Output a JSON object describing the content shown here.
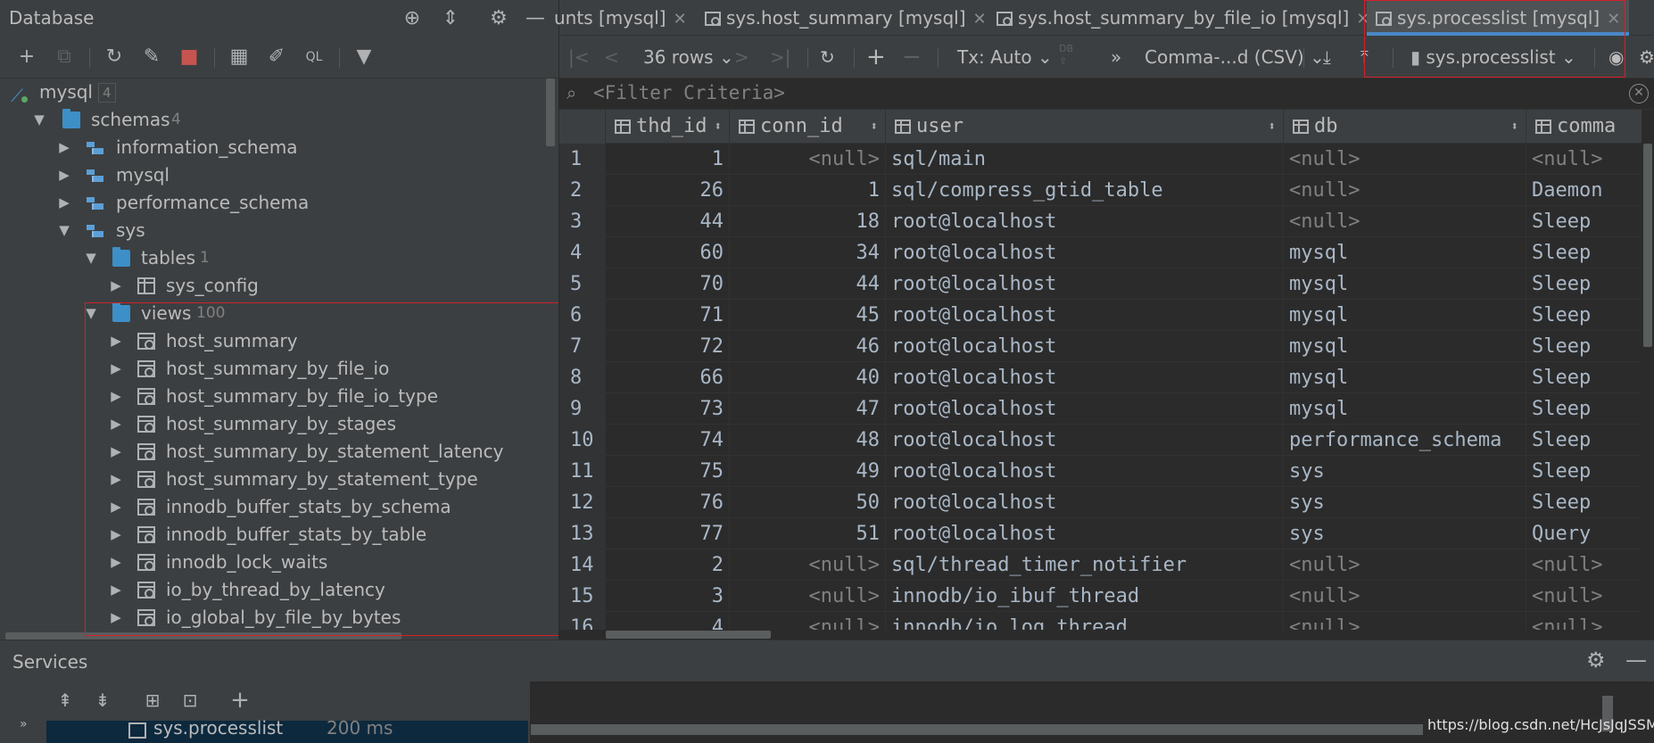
{
  "left_panel": {
    "title": "Database",
    "header_icons": [
      "globe-icon",
      "collapse-icon",
      "gear-icon",
      "minimize-icon"
    ],
    "toolbar": [
      "add-icon",
      "copy-icon",
      "refresh-icon",
      "properties-icon",
      "stop-icon",
      "table-icon",
      "edit-icon",
      "console-icon",
      "filter-icon"
    ],
    "tree": {
      "connection": {
        "label": "mysql",
        "count": "4"
      },
      "schemas": {
        "label": "schemas",
        "count": "4"
      },
      "schema_items": [
        "information_schema",
        "mysql",
        "performance_schema",
        "sys"
      ],
      "tables": {
        "label": "tables",
        "count": "1"
      },
      "table_items": [
        "sys_config"
      ],
      "views": {
        "label": "views",
        "count": "100"
      },
      "view_items": [
        "host_summary",
        "host_summary_by_file_io",
        "host_summary_by_file_io_type",
        "host_summary_by_stages",
        "host_summary_by_statement_latency",
        "host_summary_by_statement_type",
        "innodb_buffer_stats_by_schema",
        "innodb_buffer_stats_by_table",
        "innodb_lock_waits",
        "io_by_thread_by_latency",
        "io_global_by_file_by_bytes"
      ]
    }
  },
  "tabs": [
    {
      "label": "unts [mysql]"
    },
    {
      "label": "sys.host_summary [mysql]"
    },
    {
      "label": "sys.host_summary_by_file_io [mysql]"
    },
    {
      "label": "sys.processlist [mysql]",
      "active": true
    }
  ],
  "result_toolbar": {
    "rows_label": "36 rows",
    "tx_label": "Tx: Auto",
    "db_label": "DB",
    "export_format": "Comma-...d (CSV)",
    "target_label": "sys.processlist",
    "more_label": "»"
  },
  "filter": {
    "placeholder": "<Filter Criteria>"
  },
  "grid": {
    "columns": [
      "thd_id",
      "conn_id",
      "user",
      "db",
      "comma"
    ],
    "rows": [
      [
        "1",
        "1",
        "<null>",
        "sql/main",
        "<null>",
        "<null>"
      ],
      [
        "2",
        "26",
        "1",
        "sql/compress_gtid_table",
        "<null>",
        "Daemon"
      ],
      [
        "3",
        "44",
        "18",
        "root@localhost",
        "<null>",
        "Sleep"
      ],
      [
        "4",
        "60",
        "34",
        "root@localhost",
        "mysql",
        "Sleep"
      ],
      [
        "5",
        "70",
        "44",
        "root@localhost",
        "mysql",
        "Sleep"
      ],
      [
        "6",
        "71",
        "45",
        "root@localhost",
        "mysql",
        "Sleep"
      ],
      [
        "7",
        "72",
        "46",
        "root@localhost",
        "mysql",
        "Sleep"
      ],
      [
        "8",
        "66",
        "40",
        "root@localhost",
        "mysql",
        "Sleep"
      ],
      [
        "9",
        "73",
        "47",
        "root@localhost",
        "mysql",
        "Sleep"
      ],
      [
        "10",
        "74",
        "48",
        "root@localhost",
        "performance_schema",
        "Sleep"
      ],
      [
        "11",
        "75",
        "49",
        "root@localhost",
        "sys",
        "Sleep"
      ],
      [
        "12",
        "76",
        "50",
        "root@localhost",
        "sys",
        "Sleep"
      ],
      [
        "13",
        "77",
        "51",
        "root@localhost",
        "sys",
        "Query"
      ],
      [
        "14",
        "2",
        "<null>",
        "sql/thread_timer_notifier",
        "<null>",
        "<null>"
      ],
      [
        "15",
        "3",
        "<null>",
        "innodb/io_ibuf_thread",
        "<null>",
        "<null>"
      ],
      [
        "16",
        "4",
        "<null>",
        "innodb/io_log_thread",
        "<null>",
        "<null>"
      ]
    ]
  },
  "services": {
    "title": "Services",
    "item_label": "sys.processlist",
    "item_time": "200 ms",
    "expand_label": "»"
  },
  "watermark": "https://blog.csdn.net/HcJsJqJSSM",
  "colors": {
    "accent": "#4a88c7",
    "highlight_border": "#d4202a",
    "selection": "#0d293e",
    "folder": "#3d8fc8"
  }
}
